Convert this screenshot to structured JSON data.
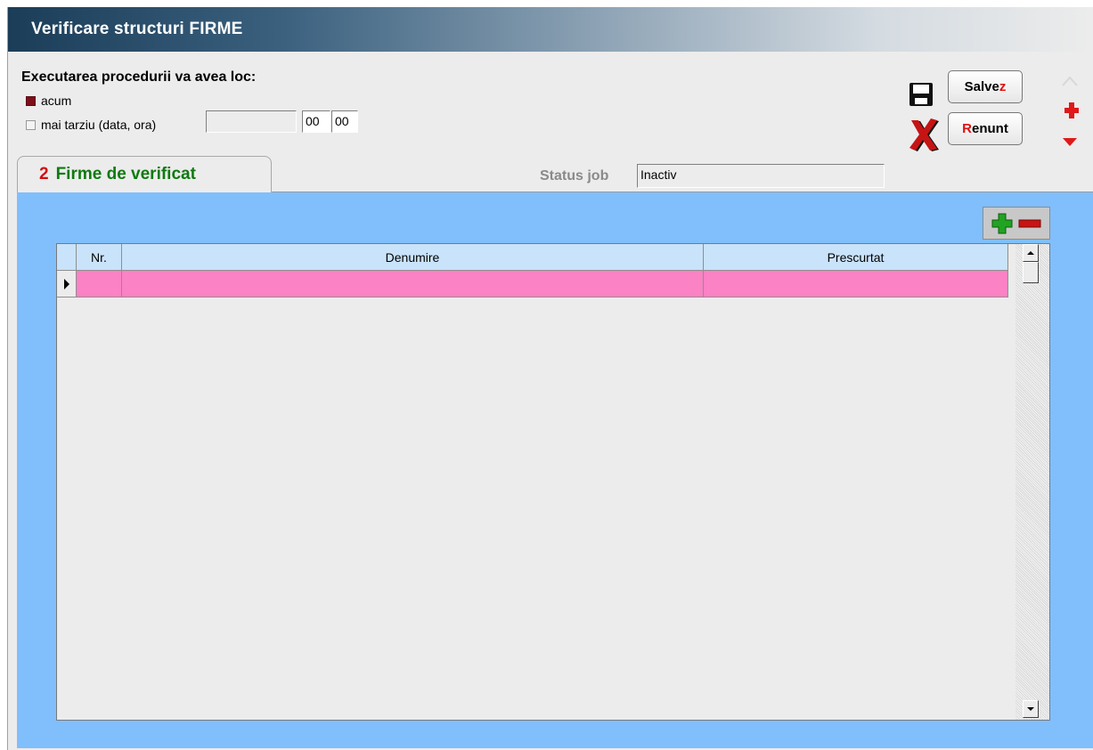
{
  "window": {
    "title": "Verificare structuri FIRME"
  },
  "execution": {
    "label": "Executarea procedurii va avea loc:",
    "option_now": "acum",
    "option_later": "mai tarziu (data, ora)",
    "date_value": "",
    "hour": "00",
    "minute": "00",
    "selected": "acum"
  },
  "buttons": {
    "save_main": "Salve",
    "save_hotkey": "z",
    "cancel_hotkey": "R",
    "cancel_rest": "enunt"
  },
  "tab": {
    "number": "2",
    "label": "Firme de verificat"
  },
  "status": {
    "label": "Status job",
    "value": "Inactiv"
  },
  "grid": {
    "columns": [
      "Nr.",
      "Denumire",
      "Prescurtat"
    ],
    "rows": [
      {
        "nr": "",
        "denumire": "",
        "prescurtat": ""
      }
    ]
  },
  "colors": {
    "panel": "#80bffc",
    "row_selected": "#fb82c4",
    "header": "#c9e3fb",
    "radio_selected": "#7d0f1a"
  },
  "icons": [
    "save-icon",
    "cancel-x-icon",
    "arrow-up-icon",
    "plus-icon",
    "arrow-down-icon",
    "add-row-icon",
    "remove-row-icon",
    "row-pointer-icon",
    "scroll-up-icon",
    "scroll-down-icon"
  ]
}
